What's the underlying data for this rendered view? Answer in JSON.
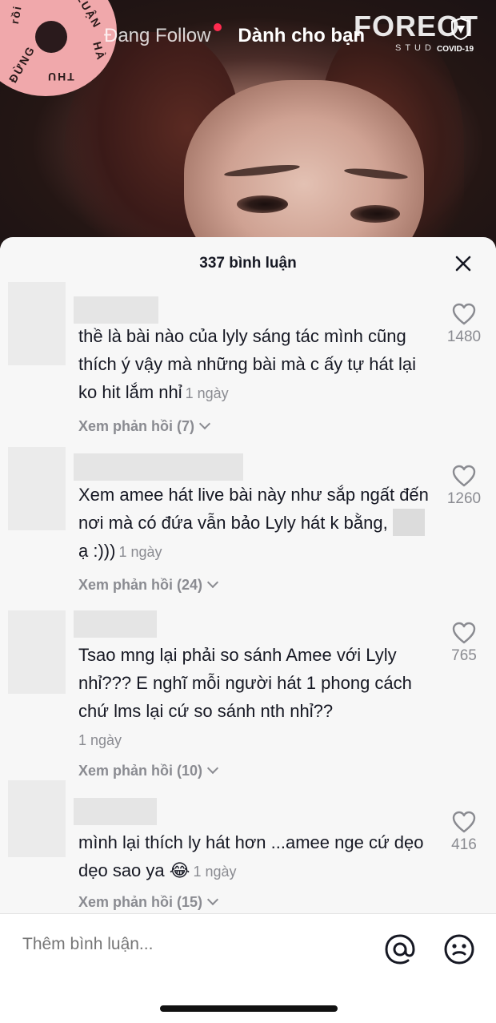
{
  "top": {
    "tab_following": "Đang Follow",
    "tab_foryou": "Dành cho bạn",
    "watermark": "FOREOT",
    "watermark_sub": "STUD",
    "watermark_covid": "COVID-19",
    "record_text": [
      "ĐỪNG",
      "rồi",
      "THU",
      "HÀ",
      "LUẬN"
    ]
  },
  "sheet": {
    "comment_count": "337 bình luận"
  },
  "comments": [
    {
      "text": "thề là bài nào của lyly sáng tác mình cũng thích ý vậy mà những bài mà c ấy tự hát lại ko hit lắm nhỉ",
      "time": "1 ngày",
      "replies": "Xem phản hồi (7)",
      "likes": "1480"
    },
    {
      "text_before": "Xem amee hát live bài này như sắp ngất đến nơi mà có đứa vẫn bảo Lyly hát k bằng,",
      "text_after": "ạ :)))",
      "time": "1 ngày",
      "replies": "Xem phản hồi (24)",
      "likes": "1260"
    },
    {
      "text": "Tsao mng lại phải so sánh Amee với Lyly nhỉ??? E nghĩ mỗi người hát 1 phong cách chứ lms lại cứ so sánh nth nhỉ??",
      "time": "1 ngày",
      "replies": "Xem phản hồi (10)",
      "likes": "765"
    },
    {
      "text": "mình lại thích ly hát hơn ...amee nge cứ dẹo dẹo sao ya",
      "emoji": "😂",
      "time": "1 ngày",
      "replies": "Xem phản hồi (15)",
      "likes": "416"
    }
  ],
  "input": {
    "placeholder": "Thêm bình luận..."
  },
  "icons": {
    "close": "close-icon",
    "like": "heart-icon",
    "mention": "at-icon",
    "emoji": "emoji-icon"
  }
}
